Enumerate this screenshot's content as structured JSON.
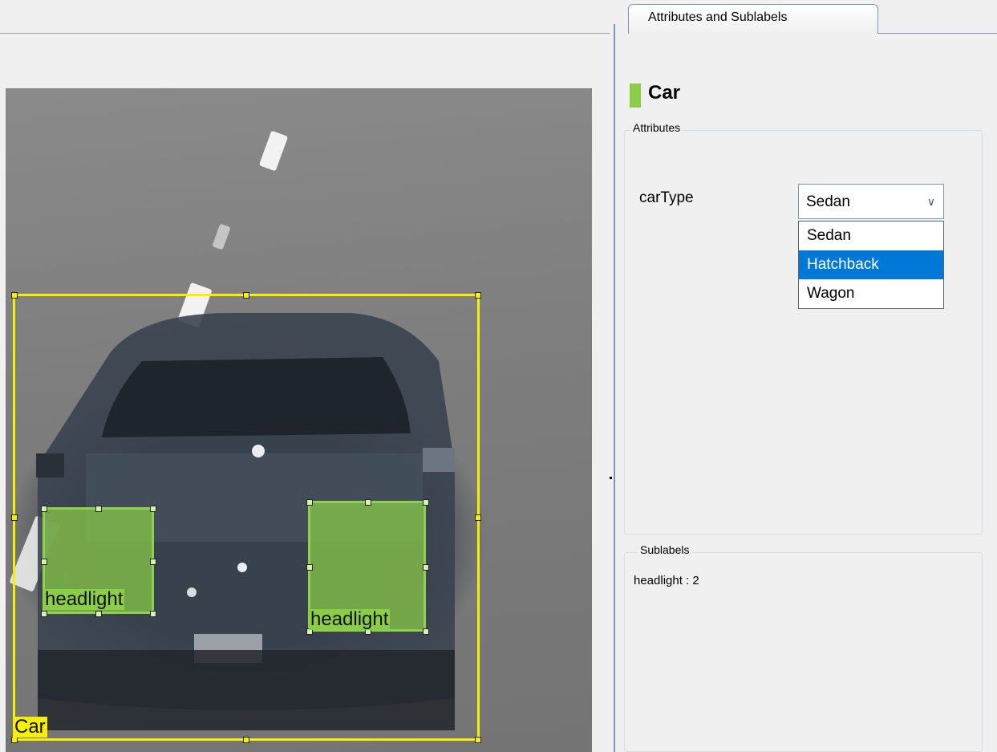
{
  "tab": {
    "label": "Attributes and Sublabels"
  },
  "label": {
    "name": "Car",
    "color": "#8bcd46"
  },
  "attributes": {
    "title": "Attributes",
    "field_name": "carType",
    "selected_value": "Sedan",
    "options": [
      "Sedan",
      "Hatchback",
      "Wagon"
    ],
    "highlighted_option": "Hatchback"
  },
  "sublabels": {
    "title": "Sublabels",
    "entries": [
      "headlight : 2"
    ]
  },
  "annotations": {
    "car": {
      "label": "Car",
      "color": "#f5ef00"
    },
    "headlights": [
      {
        "label": "headlight",
        "color": "#8bcd46"
      },
      {
        "label": "headlight",
        "color": "#8bcd46"
      }
    ]
  },
  "icons": {
    "dropdown_arrow": "chevron-down-icon"
  }
}
